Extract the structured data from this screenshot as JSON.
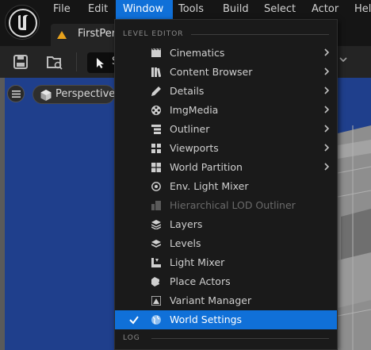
{
  "menubar": {
    "items": [
      {
        "label": "File"
      },
      {
        "label": "Edit"
      },
      {
        "label": "Window"
      },
      {
        "label": "Tools"
      },
      {
        "label": "Build"
      },
      {
        "label": "Select"
      },
      {
        "label": "Actor"
      },
      {
        "label": "Help"
      }
    ],
    "active": "Window"
  },
  "tabs": {
    "level_tab_label": "FirstPer"
  },
  "toolbar": {
    "mode_label": "S"
  },
  "viewport": {
    "perspective_label": "Perspective"
  },
  "window_menu": {
    "sections": [
      {
        "header": "LEVEL EDITOR",
        "items": [
          {
            "label": "Cinematics",
            "icon": "film-icon",
            "submenu": true
          },
          {
            "label": "Content Browser",
            "icon": "content-browser-icon",
            "submenu": true
          },
          {
            "label": "Details",
            "icon": "pencil-icon",
            "submenu": true
          },
          {
            "label": "ImgMedia",
            "icon": "film-reel-icon",
            "submenu": true
          },
          {
            "label": "Outliner",
            "icon": "list-icon",
            "submenu": true
          },
          {
            "label": "Viewports",
            "icon": "grid-icon",
            "submenu": true
          },
          {
            "label": "World Partition",
            "icon": "partition-grid-icon",
            "submenu": true
          },
          {
            "label": "Env. Light Mixer",
            "icon": "light-mixer-icon",
            "submenu": false
          },
          {
            "label": "Hierarchical LOD Outliner",
            "icon": "hlod-icon",
            "submenu": false,
            "disabled": true
          },
          {
            "label": "Layers",
            "icon": "layers-icon",
            "submenu": false
          },
          {
            "label": "Levels",
            "icon": "levels-icon",
            "submenu": false
          },
          {
            "label": "Light Mixer",
            "icon": "light-mixer-icon",
            "submenu": false
          },
          {
            "label": "Place Actors",
            "icon": "place-actors-icon",
            "submenu": false
          },
          {
            "label": "Variant Manager",
            "icon": "variant-manager-icon",
            "submenu": false
          },
          {
            "label": "World Settings",
            "icon": "globe-icon",
            "submenu": false,
            "checked": true,
            "selected": true
          }
        ]
      },
      {
        "header": "LOG",
        "items": []
      }
    ]
  },
  "colors": {
    "accent": "#1070d8",
    "menu_bg": "#1a1a1a",
    "viewport_sky": "#1f3f8c",
    "tab_icon": "#e8a21c"
  }
}
